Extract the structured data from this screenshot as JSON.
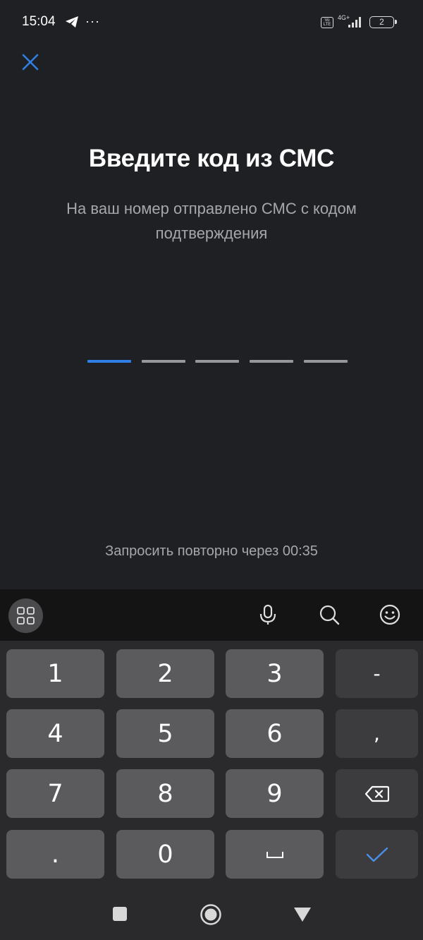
{
  "status_bar": {
    "time": "15:04",
    "more": "···",
    "volte": "Vo LTE",
    "network": "4G+",
    "battery": "2"
  },
  "icons": {
    "close": "close-icon",
    "telegram": "telegram-icon",
    "apps": "grid-icon",
    "mic": "microphone-icon",
    "search": "search-icon",
    "emoji": "emoji-icon",
    "backspace": "backspace-icon",
    "done": "checkmark-icon",
    "space": "space-icon"
  },
  "main": {
    "title": "Введите код из СМС",
    "subtitle": "На ваш номер отправлено СМС с кодом подтверждения",
    "code_length": 5,
    "resend_text": "Запросить повторно через 00:35"
  },
  "keyboard": {
    "rows": [
      [
        "1",
        "2",
        "3",
        "-"
      ],
      [
        "4",
        "5",
        "6",
        ","
      ],
      [
        "7",
        "8",
        "9",
        ""
      ],
      [
        ".",
        "0",
        "",
        ""
      ]
    ]
  },
  "colors": {
    "background": "#1f2023",
    "accent": "#2f7fe4",
    "text_secondary": "#a6a7ab"
  }
}
